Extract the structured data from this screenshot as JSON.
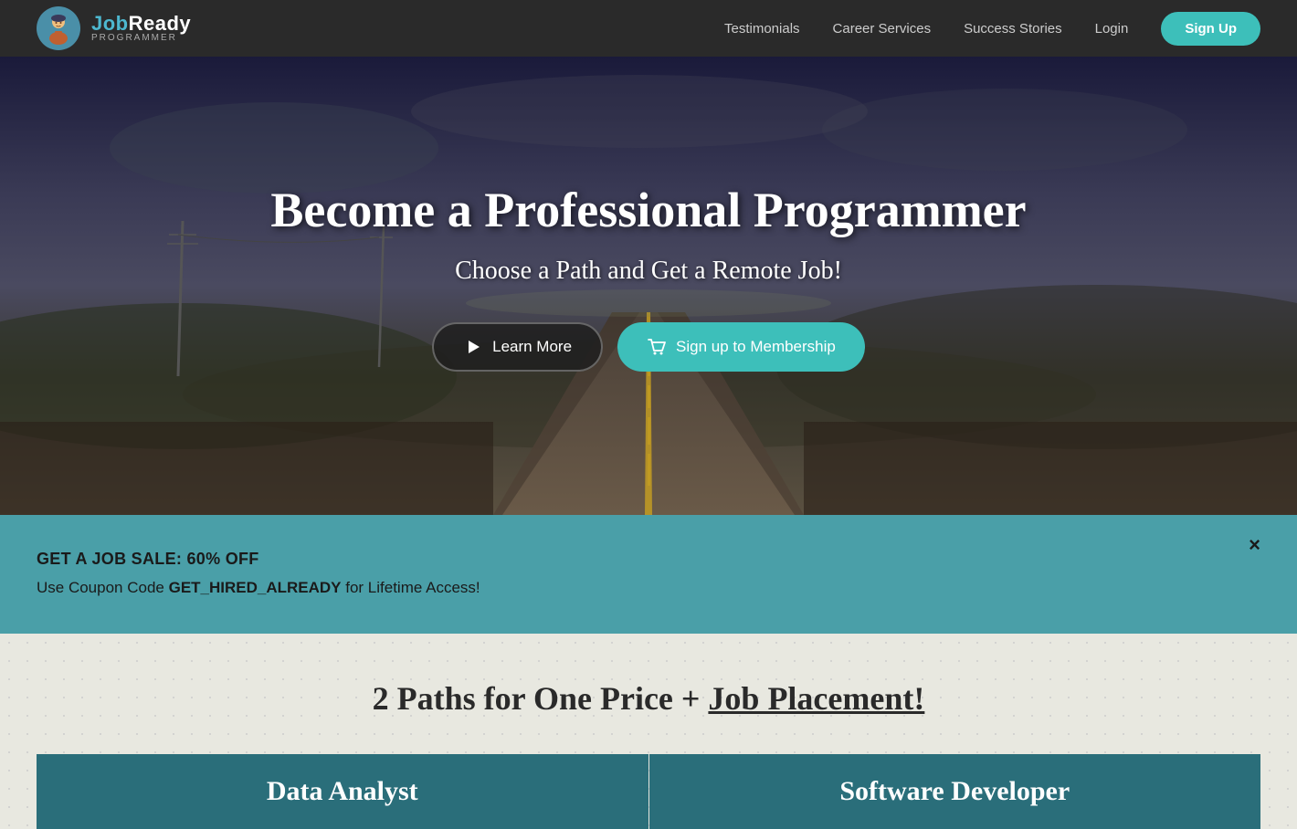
{
  "navbar": {
    "logo_text_top_job": "Job",
    "logo_text_top_ready": "Ready",
    "logo_text_bottom": "PROGRAMMER",
    "links": [
      {
        "id": "testimonials",
        "label": "Testimonials"
      },
      {
        "id": "career-services",
        "label": "Career Services"
      },
      {
        "id": "success-stories",
        "label": "Success Stories"
      },
      {
        "id": "login",
        "label": "Login"
      }
    ],
    "signup_label": "Sign Up"
  },
  "hero": {
    "title": "Become a Professional Programmer",
    "subtitle": "Choose a Path and Get a Remote Job!",
    "btn_learn_more": "Learn More",
    "btn_signup": "Sign up to Membership"
  },
  "promo": {
    "title": "GET A JOB SALE: 60% OFF",
    "text_prefix": "Use Coupon Code ",
    "coupon_code": "GET_HIRED_ALREADY",
    "text_suffix": " for Lifetime Access!",
    "close_label": "×"
  },
  "paths_section": {
    "title_prefix": "2 Paths for One Price + ",
    "title_highlight": "Job Placement!",
    "card1_title": "Data Analyst",
    "card2_title": "Software Developer"
  }
}
